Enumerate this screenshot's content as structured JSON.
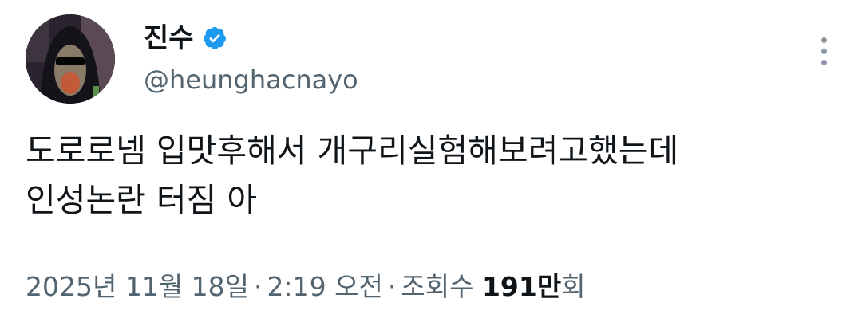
{
  "author": {
    "display_name": "진수",
    "handle": "@heunghacnayo",
    "verified": true,
    "verified_color": "#1d9bf0"
  },
  "tweet": {
    "lines": [
      "도로로넴 입맛후해서 개구리실험해보려고했는데",
      "인성논란 터짐 아"
    ]
  },
  "meta": {
    "date": "2025년 11월 18일",
    "separator": "·",
    "time": "2:19 오전",
    "views_label": "조회수",
    "views_count": "191만",
    "views_suffix": "회"
  },
  "icons": {
    "more": "more-vertical-icon",
    "verified": "verified-badge-icon"
  }
}
